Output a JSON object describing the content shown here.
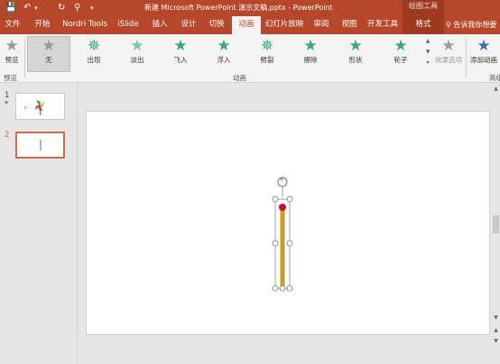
{
  "quick_access": {
    "save_icon": "save-icon",
    "undo_icon": "undo-icon",
    "redo_icon": "redo-icon",
    "preview_icon": "preview-icon",
    "customize_icon": "customize-icon"
  },
  "title": "新建 Microsoft PowerPoint 演示文稿.pptx  -  PowerPoint",
  "context_group": "绘图工具",
  "tabs": [
    {
      "label": "文件"
    },
    {
      "label": "开始"
    },
    {
      "label": "Nordri Tools"
    },
    {
      "label": "iSlide"
    },
    {
      "label": "插入"
    },
    {
      "label": "设计"
    },
    {
      "label": "切换"
    },
    {
      "label": "动画"
    },
    {
      "label": "幻灯片放映"
    },
    {
      "label": "审阅"
    },
    {
      "label": "视图"
    },
    {
      "label": "开发工具"
    },
    {
      "label": "格式"
    }
  ],
  "tell_me": "告诉我你想要",
  "ribbon": {
    "preview": "预览",
    "preview_group": "预览",
    "gallery": [
      {
        "label": "无"
      },
      {
        "label": "出现"
      },
      {
        "label": "淡出"
      },
      {
        "label": "飞入"
      },
      {
        "label": "浮入"
      },
      {
        "label": "劈裂"
      },
      {
        "label": "擦除"
      },
      {
        "label": "形状"
      },
      {
        "label": "轮子"
      }
    ],
    "animation_group": "动画",
    "effect_options": "效果选项",
    "add_animation": "添加动画",
    "advanced_group": "高级",
    "colors": {
      "star_active": "#3aa57f",
      "star_none": "#9a9a9a",
      "accent": "#b7472a"
    }
  },
  "slides": [
    {
      "number": "1",
      "marker": "*"
    },
    {
      "number": "2"
    }
  ]
}
